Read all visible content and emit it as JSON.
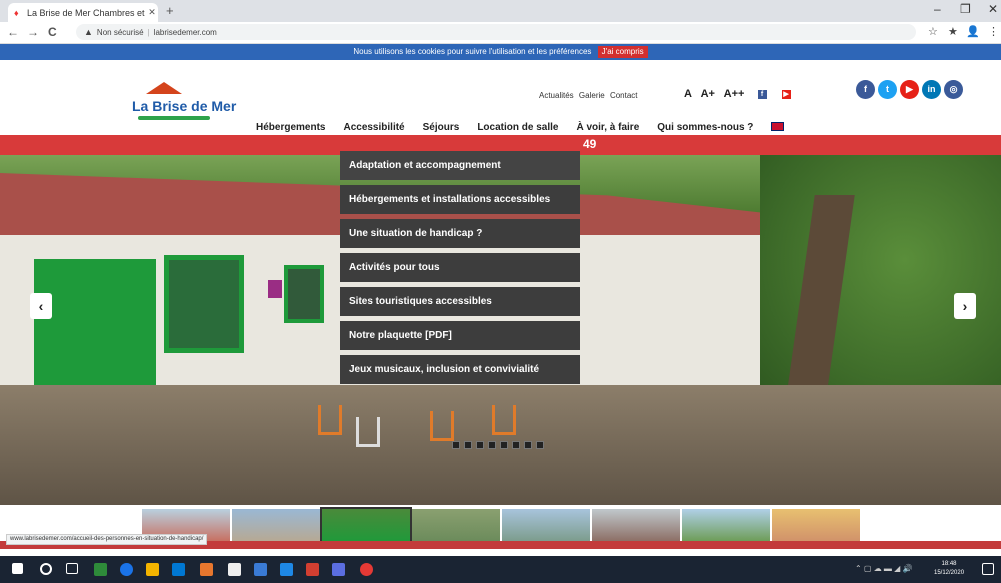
{
  "browser": {
    "tab_title": "La Brise de Mer Chambres et gîte",
    "tab_close": "✕",
    "new_tab": "+",
    "window_controls": [
      "–",
      "❐",
      "✕"
    ],
    "nav": [
      "←",
      "→",
      "C"
    ],
    "security_label": "Non sécurisé",
    "url": "labrisedemer.com",
    "right_icons": [
      "☆",
      "★",
      "👤",
      "⋮"
    ]
  },
  "cookie_bar": {
    "text": "Nous utilisons les cookies pour suivre l'utilisation et les préférences",
    "button": "J'ai compris"
  },
  "header": {
    "logo_text": "La Brise de Mer",
    "top_links": [
      "Actualités",
      "Galerie",
      "Contact"
    ],
    "text_sizes": [
      "A",
      "A+",
      "A++"
    ],
    "social": [
      {
        "name": "facebook",
        "glyph": "f",
        "color": "#3b5998"
      },
      {
        "name": "twitter",
        "glyph": "t",
        "color": "#1da1f2"
      },
      {
        "name": "youtube",
        "glyph": "▶",
        "color": "#e62117"
      },
      {
        "name": "linkedin",
        "glyph": "in",
        "color": "#0077b5"
      },
      {
        "name": "instagram",
        "glyph": "◎",
        "color": "#3a5a99"
      }
    ],
    "nav": [
      "Hébergements",
      "Accessibilité",
      "Séjours",
      "Location de salle",
      "À voir, à faire",
      "Qui sommes-nous ?"
    ],
    "red_bar_text": "49"
  },
  "dropdown": {
    "items": [
      "Adaptation et accompagnement",
      "Hébergements et installations accessibles",
      "Une situation de handicap ?",
      "Activités pour tous",
      "Sites touristiques accessibles",
      "Notre plaquette [PDF]",
      "Jeux musicaux, inclusion et convivialité"
    ]
  },
  "slider": {
    "prev": "‹",
    "next": "›",
    "dot_count": 8
  },
  "status_url": "www.labrisedemer.com/accueil-des-personnes-en-situation-de-handicap/",
  "taskbar": {
    "time": "18:48",
    "date": "15/12/2020"
  }
}
